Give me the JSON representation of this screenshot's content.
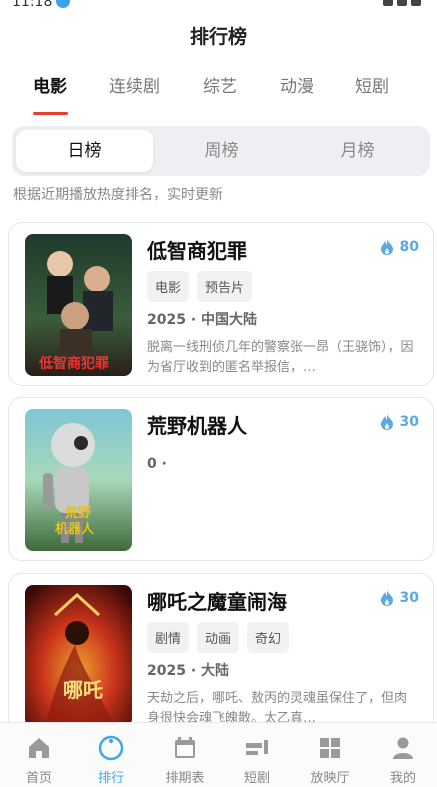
{
  "status_bar": {
    "time": "11:18"
  },
  "page_title": "排行榜",
  "category_tabs": [
    {
      "label": "电影",
      "active": true
    },
    {
      "label": "连续剧",
      "active": false
    },
    {
      "label": "综艺",
      "active": false
    },
    {
      "label": "动漫",
      "active": false
    },
    {
      "label": "短剧",
      "active": false
    }
  ],
  "period_tabs": [
    {
      "label": "日榜",
      "active": true
    },
    {
      "label": "周榜",
      "active": false
    },
    {
      "label": "月榜",
      "active": false
    }
  ],
  "subtitle": "根据近期播放热度排名，实时更新",
  "accent_color": "#e8412f",
  "heat_color": "#5aa8e6",
  "items": [
    {
      "title": "低智商犯罪",
      "heat": "80",
      "tags": [
        "电影",
        "预告片"
      ],
      "meta": "2025 · 中国大陆",
      "desc": "脱离一线刑侦几年的警察张一昂（王骁饰），因为省厅收到的匿名举报信，…"
    },
    {
      "title": "荒野机器人",
      "heat": "30",
      "tags": [],
      "meta": "0 ·",
      "desc": ""
    },
    {
      "title": "哪吒之魔童闹海",
      "heat": "30",
      "tags": [
        "剧情",
        "动画",
        "奇幻"
      ],
      "meta": "2025 · 大陆",
      "desc": "天劫之后，哪吒、敖丙的灵魂虽保住了，但肉身很快会魂飞魄散。太乙真…"
    }
  ],
  "tabbar": [
    {
      "label": "首页",
      "icon": "home-icon",
      "active": false
    },
    {
      "label": "排行",
      "icon": "ranking-icon",
      "active": true
    },
    {
      "label": "排期表",
      "icon": "calendar-icon",
      "active": false
    },
    {
      "label": "短剧",
      "icon": "short-drama-icon",
      "active": false
    },
    {
      "label": "放映厅",
      "icon": "grid-icon",
      "active": false
    },
    {
      "label": "我的",
      "icon": "user-icon",
      "active": false
    }
  ]
}
